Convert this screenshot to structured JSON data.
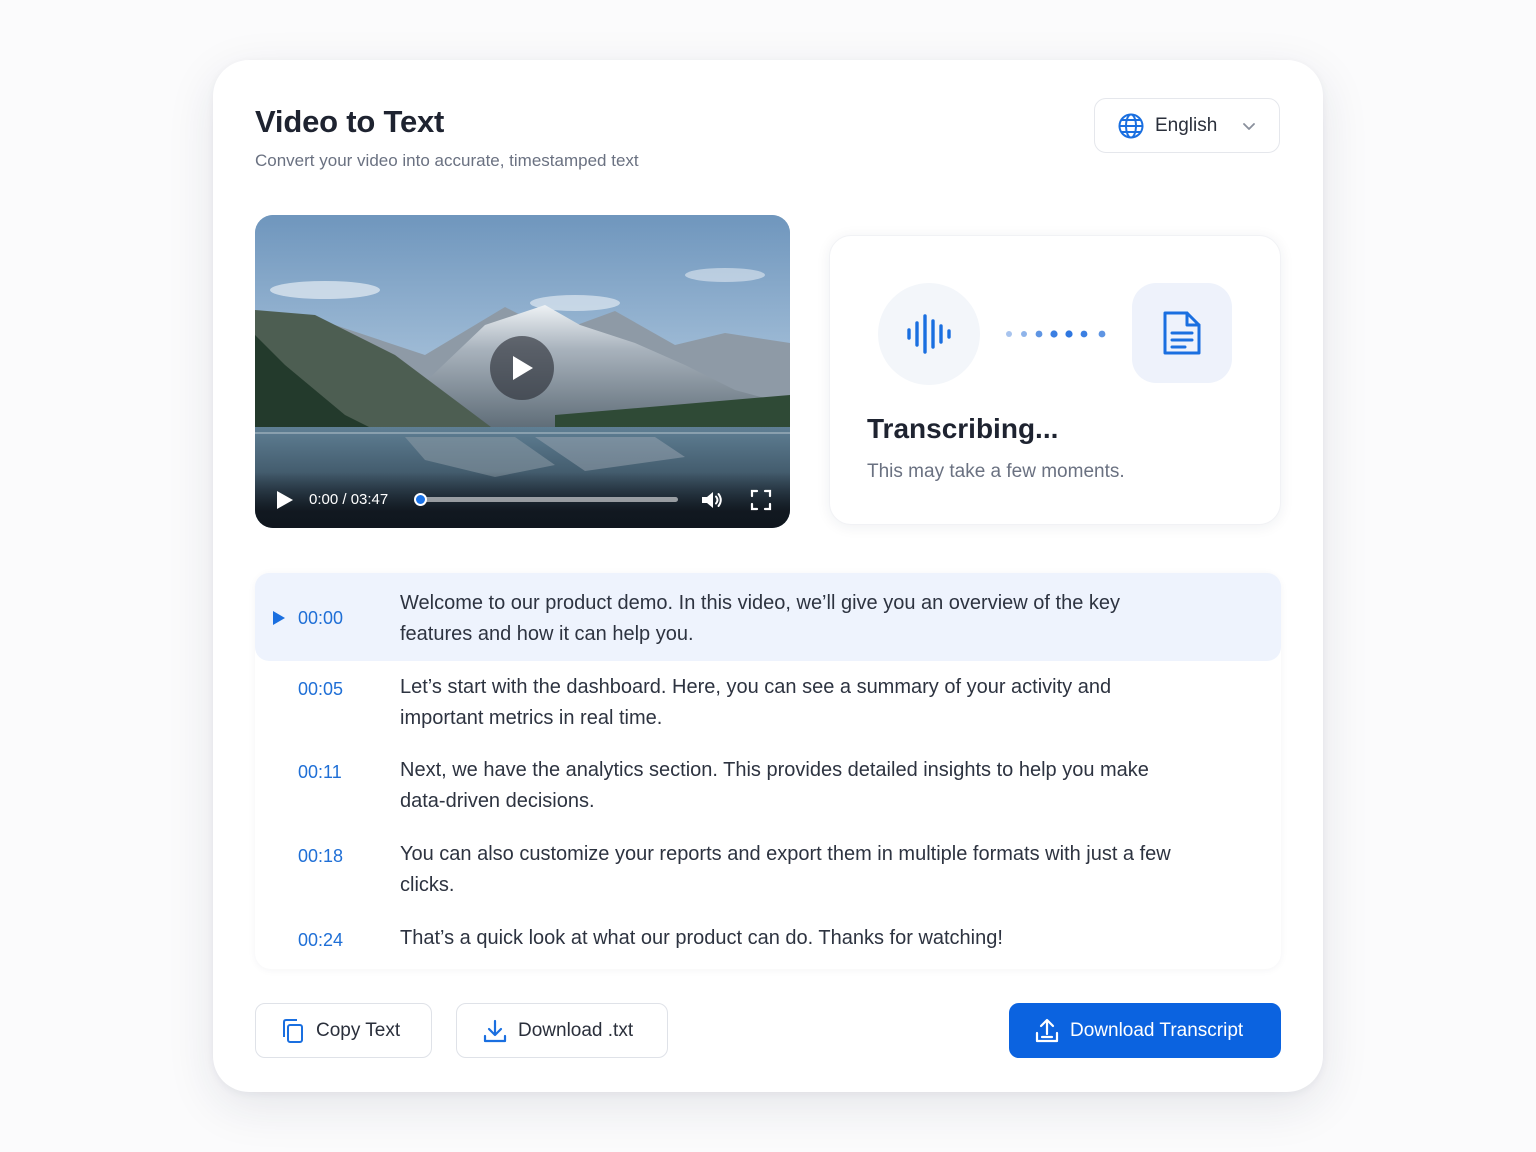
{
  "header": {
    "title": "Video to Text",
    "subtitle": "Convert your video into accurate, timestamped text"
  },
  "language_select": {
    "value": "English",
    "icon": "globe-icon"
  },
  "video_player": {
    "time_display": "0:00 / 03:47",
    "progress_fraction": 0.0,
    "icons": [
      "play-icon",
      "volume-icon",
      "fullscreen-icon"
    ]
  },
  "status": {
    "title": "Transcribing...",
    "message": "This may take a few moments.",
    "icons": [
      "audio-wave-icon",
      "document-icon"
    ]
  },
  "transcript": [
    {
      "time": "00:00",
      "text": "Welcome to our product demo. In this video, we’ll give you an overview of the key features and how it can help you.",
      "active": true
    },
    {
      "time": "00:05",
      "text": "Let’s start with the dashboard. Here, you can see a summary of your activity and important metrics in real time.",
      "active": false
    },
    {
      "time": "00:11",
      "text": "Next, we have the analytics section. This provides detailed insights to help you make data-driven decisions.",
      "active": false
    },
    {
      "time": "00:18",
      "text": "You can also customize your reports and export them in multiple formats with just a few clicks.",
      "active": false
    },
    {
      "time": "00:24",
      "text": "That’s a quick look at what our product can do. Thanks for watching!",
      "active": false
    }
  ],
  "actions": {
    "copy_label": "Copy Text",
    "download_txt_label": "Download .txt",
    "download_transcript_label": "Download Transcript"
  },
  "colors": {
    "accent": "#0b63e0",
    "timestamp": "#1f6fd6",
    "active_row": "#eef3fd"
  }
}
